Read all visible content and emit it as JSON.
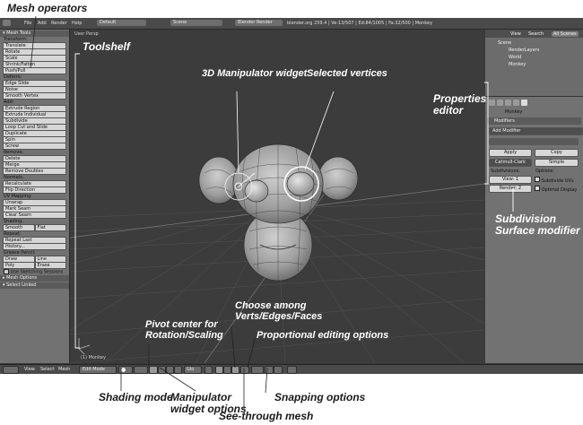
{
  "callouts": {
    "mesh_operators": "Mesh operators",
    "toolshelf": "Toolshelf",
    "manipulator_widget": "3D Manipulator widget",
    "selected_vertices": "Selected vertices",
    "properties_editor_line1": "Properties",
    "properties_editor_line2": "editor",
    "subdivision_line1": "Subdivision",
    "subdivision_line2": "Surface modifier",
    "choose_line1": "Choose among",
    "choose_line2": "Verts/Edges/Faces",
    "pivot_line1": "Pivot center for",
    "pivot_line2": "Rotation/Scaling",
    "proportional": "Proportional editing options",
    "shading_mode": "Shading mode",
    "manipulator_options_line1": "Manipulator",
    "manipulator_options_line2": "widget options",
    "snapping": "Snapping options",
    "see_through": "See-through mesh"
  },
  "info_bar": {
    "menus": [
      "File",
      "Add",
      "Render",
      "Help"
    ],
    "layout": "Default",
    "scene": "Scene",
    "engine": "Blender Render",
    "stats": "blender.org 259.4 | Ve:13/507 | Ed:84/1005 | Fa:32/500 | Monkey"
  },
  "toolshelf": {
    "header": "Mesh Tools",
    "sections": [
      {
        "title": "Transform:",
        "buttons": [
          "Translate",
          "Rotate",
          "Scale",
          "Shrink/Fatten",
          "Push/Pull"
        ]
      },
      {
        "title": "Deform:",
        "buttons": [
          "Edge Slide",
          "Noise",
          "Smooth Vertex"
        ]
      },
      {
        "title": "Add:",
        "buttons": [
          "Extrude Region",
          "Extrude Individual",
          "Subdivide",
          "Loop Cut and Slide",
          "Duplicate",
          "Spin",
          "Screw"
        ]
      },
      {
        "title": "Remove:",
        "buttons": [
          "Delete",
          "Merge",
          "Remove Doubles"
        ]
      },
      {
        "title": "Normals:",
        "buttons": [
          "Recalculate",
          "Flip Direction"
        ]
      },
      {
        "title": "UV Mapping:",
        "buttons": [
          "Unwrap",
          "Mark Seam",
          "Clear Seam"
        ]
      }
    ],
    "shading_title": "Shading:",
    "shading_buttons": [
      "Smooth",
      "Flat"
    ],
    "repeat_title": "Repeat:",
    "repeat_buttons": [
      "Repeat Last",
      "History..."
    ],
    "grease_title": "Grease Pencil:",
    "grease_rows": [
      [
        "Draw",
        "Line"
      ],
      [
        "Poly",
        "Erase"
      ]
    ],
    "sketching": "Use Sketching Sessions",
    "footer": [
      "Mesh Options",
      "Select Linked"
    ]
  },
  "viewport": {
    "title": "User Persp",
    "corner": "(1) Monkey"
  },
  "properties": {
    "tabs": [
      "View",
      "Search",
      "All Scenes"
    ],
    "outliner": [
      "Scene",
      "RenderLayers",
      "World",
      "Monkey"
    ],
    "object_name": "Monkey",
    "panel_title": "Modifiers",
    "add_modifier": "Add Modifier",
    "apply": "Apply",
    "copy": "Copy",
    "catmull_clark": "Catmull-Clark",
    "simple": "Simple",
    "subdivisions_label": "Subdivisions:",
    "options_label": "Options:",
    "view_value": "View: 1",
    "render_value": "Render: 2",
    "subdivide_uvs": "Subdivide UVs",
    "optimal_display": "Optimal Display"
  },
  "bottom_header": {
    "menus": [
      "View",
      "Select",
      "Mesh"
    ],
    "mode": "Edit Mode",
    "global": "Glo"
  }
}
